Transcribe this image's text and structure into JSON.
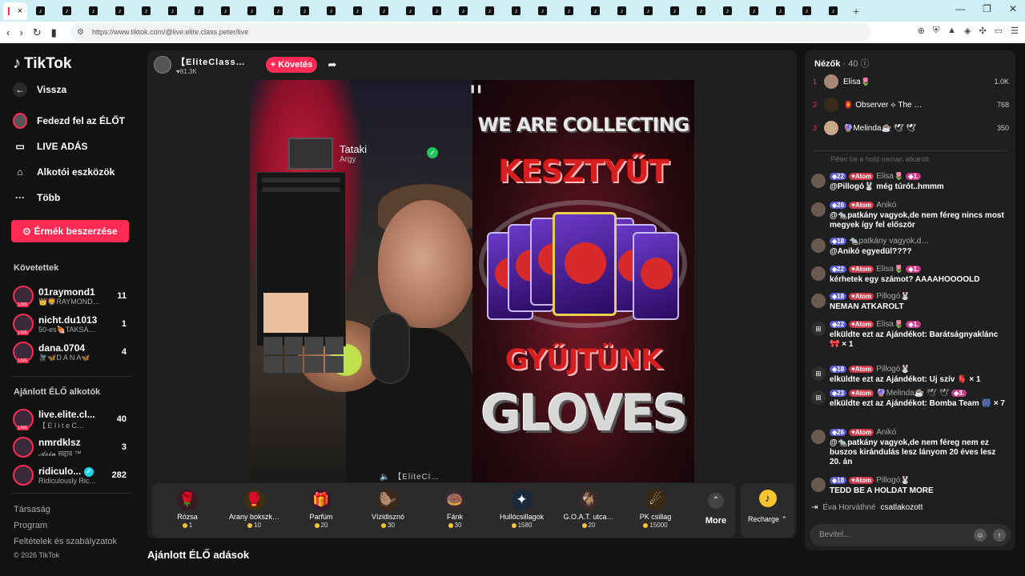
{
  "browser": {
    "tab_count": 32,
    "url": "https://www.tiktok.com/@live.elite.class.peter/live"
  },
  "sidebar": {
    "logo": "TikTok",
    "back": "Vissza",
    "nav": [
      {
        "label": "Fedezd fel az ÉLŐT",
        "icon": "live-avatar-icon"
      },
      {
        "label": "LIVE ADÁS",
        "icon": "camera-icon"
      },
      {
        "label": "Alkotói eszközök",
        "icon": "home-tools-icon"
      },
      {
        "label": "Több",
        "icon": "more-dots-icon"
      }
    ],
    "coins_button": "Érmék beszerzése",
    "followed_title": "Követettek",
    "followed": [
      {
        "name": "01raymond1",
        "sub": "👑🦁RAYMOND…",
        "count": "11"
      },
      {
        "name": "nicht.du1013",
        "sub": "50-es🍖TAKSÁ…",
        "count": "1"
      },
      {
        "name": "dana.0704",
        "sub": "🪰🦋D A N A🦋",
        "count": "4"
      }
    ],
    "suggested_title": "Ajánlott ÉLŐ alkotók",
    "suggested": [
      {
        "name": "live.elite.cl...",
        "sub": "【 E l i t e C…",
        "count": "40"
      },
      {
        "name": "nmrdklsz",
        "sub": "𝓐𝓸𝓲𝓷 सद्दाव ™",
        "count": "3"
      },
      {
        "name": "ridiculo...",
        "sub": "Ridiculously Ric...",
        "count": "282",
        "verified": true
      }
    ],
    "footer": [
      "Társaság",
      "Program",
      "Feltételek és szabályzatok",
      "© 2026 TikTok"
    ]
  },
  "stream": {
    "host_name": "【EliteClass…",
    "likes": "♥81.3K",
    "follow": "+ Követés",
    "overlay_name": "Tataki",
    "overlay_sub": "Argy",
    "banner": {
      "line1": "WE ARE COLLECTING",
      "line2": "KESZTYŰT",
      "line3": "GYŰJTÜNK",
      "line4": "GLOVES"
    },
    "watermark": "【EliteCl…",
    "below_title": "Ajánlott ÉLŐ adások"
  },
  "gifts": [
    {
      "name": "Rózsa",
      "price": "1",
      "icon": "🌹",
      "color": "#3a1a22"
    },
    {
      "name": "Arany bokszk…",
      "price": "10",
      "icon": "🥊",
      "color": "#3a3210"
    },
    {
      "name": "Parfüm",
      "price": "20",
      "icon": "🎁",
      "color": "#3a1a30"
    },
    {
      "name": "Vízidisznó",
      "price": "30",
      "icon": "🦫",
      "color": "#3a2a1a"
    },
    {
      "name": "Fánk",
      "price": "30",
      "icon": "🍩",
      "color": "#3a2a32"
    },
    {
      "name": "Hullócsillagok",
      "price": "1580",
      "icon": "✦",
      "color": "#1a2a3a"
    },
    {
      "name": "G.O.A.T. utca…",
      "price": "20",
      "icon": "🐐",
      "color": "#3a2a2a"
    },
    {
      "name": "PK csillag",
      "price": "15000",
      "icon": "☄",
      "color": "#3a2a12"
    }
  ],
  "more_label": "More",
  "recharge_label": "Recharge",
  "viewers": {
    "title": "Nézők",
    "count": "· 40",
    "top": [
      {
        "rank": "1",
        "name": "Elisa🌷",
        "score": "1.0K"
      },
      {
        "rank": "2",
        "name": "🏮 Observer ⟡ The …",
        "score": "768"
      },
      {
        "rank": "3",
        "name": "🔮Melinda☕ 🕊 🕊",
        "score": "350"
      }
    ]
  },
  "chat": {
    "faded_line": "Péter be a hold neman atkarolt",
    "messages": [
      {
        "level": "22",
        "atom": "Atom",
        "user": "Elisa🌷",
        "rank": "1.",
        "text": "@Pillogó🐰 még túrót..hmmm",
        "gift": false
      },
      {
        "level": "26",
        "atom": "Atom",
        "user": "Anikó",
        "rank": "",
        "text": "@🐀patkány vagyok,de nem féreg nincs most megyek így fel először",
        "gift": false
      },
      {
        "level": "18",
        "atom": "",
        "user": "🐀patkány vagyok,d…",
        "rank": "",
        "text": "@Anikó egyedül????",
        "gift": false
      },
      {
        "level": "22",
        "atom": "Atom",
        "user": "Elisa🌷",
        "rank": "1.",
        "text": "kérhetek egy számot? AAAAHOOOOLD",
        "gift": false
      },
      {
        "level": "18",
        "atom": "Atom",
        "user": "Pillogó🐰",
        "rank": "",
        "text": "NEMAN ATKAROLT",
        "gift": false
      },
      {
        "level": "22",
        "atom": "Atom",
        "user": "Elisa🌷",
        "rank": "1.",
        "text": "elküldte ezt az Ajándékot: Barátságnyaklánc 🎀 × 1",
        "gift": true
      },
      {
        "level": "18",
        "atom": "Atom",
        "user": "Pillogó🐰",
        "rank": "",
        "text": "elküldte ezt az Ajándékot: Uj szív 🫀 × 1",
        "gift": true
      },
      {
        "level": "23",
        "atom": "Atom",
        "user": "🔮Melinda☕ 🕊 🕊",
        "rank": "3.",
        "text": "elküldte ezt az Ajándékot: Bomba Team 🎆 × 7",
        "gift": true
      },
      {
        "level": "26",
        "atom": "Atom",
        "user": "Anikó",
        "rank": "",
        "text": "@🐀patkány vagyok,de nem féreg nem ez buszos kirándulás lesz lányom 20 éves lesz 20. án",
        "gift": false
      },
      {
        "level": "18",
        "atom": "Atom",
        "user": "Pillogó🐰",
        "rank": "",
        "text": "TEDD BE A HOLDAT MORE",
        "gift": false
      }
    ],
    "joined_name": "Éva Horváthné",
    "joined_text": "csatlakozott",
    "input_placeholder": "Bevitel..."
  }
}
